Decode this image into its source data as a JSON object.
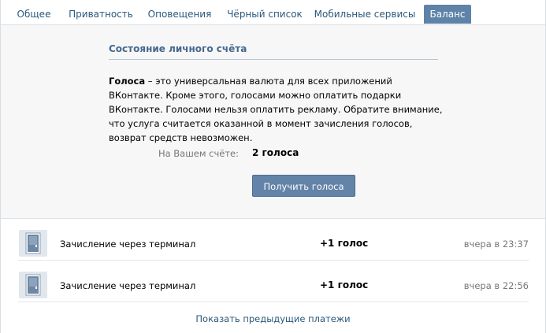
{
  "tabs": [
    {
      "label": "Общее"
    },
    {
      "label": "Приватность"
    },
    {
      "label": "Оповещения"
    },
    {
      "label": "Чёрный список"
    },
    {
      "label": "Мобильные сервисы"
    },
    {
      "label": "Баланс",
      "active": true
    }
  ],
  "balance": {
    "section_title": "Состояние личного счёта",
    "term": "Голоса",
    "description": " – это универсальная валюта для всех приложений ВКонтакте. Кроме этого, голосами можно оплатить подарки ВКонтакте. Голосами нельзя оплатить рекламу. Обратите внимание, что услуга считается оказанной в момент зачисления голосов, возврат средств невозможен.",
    "account_label": "На Вашем счёте:",
    "account_value": "2 голоса",
    "get_votes_button": "Получить голоса"
  },
  "payments": [
    {
      "icon": "terminal-door-icon",
      "description": "Зачисление через терминал",
      "amount": "+1 голос",
      "time": "вчера в 23:37"
    },
    {
      "icon": "terminal-door-icon",
      "description": "Зачисление через терминал",
      "amount": "+1 голос",
      "time": "вчера в 22:56"
    }
  ],
  "show_previous_link": "Показать предыдущие платежи",
  "colors": {
    "accent": "#5e82a8",
    "link": "#2b587a",
    "panel_bg": "#f7f7f7"
  }
}
